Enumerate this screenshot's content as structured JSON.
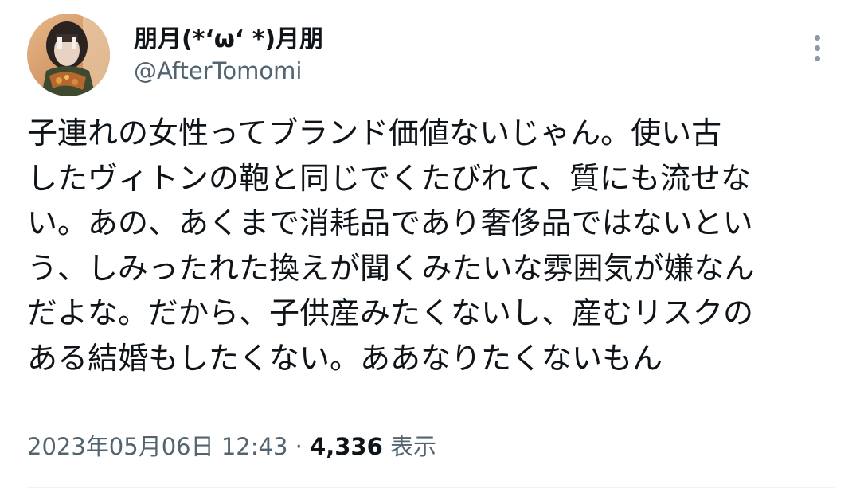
{
  "tweet": {
    "author": {
      "display_name": "朋月(*‘ω‘ *)月朋",
      "handle": "@AfterTomomi"
    },
    "text_lines": [
      "子連れの女性ってブランド価値ないじゃん。使い古",
      "したヴィトンの鞄と同じでくたびれて、質にも流せな",
      "い。あの、あくまで消耗品であり奢侈品ではないとい",
      "う、しみったれた換えが聞くみたいな雰囲気が嫌なん",
      "だよな。だから、子供産みたくないし、産むリスクの",
      "ある結婚もしたくない。ああなりたくないもん"
    ],
    "timestamp": "2023年05月06日 12:43",
    "separator": " · ",
    "views_count": "4,336",
    "views_label": " 表示",
    "more_icon": "more-vertical-icon"
  },
  "colors": {
    "text_primary": "#0f1419",
    "text_secondary": "#536471",
    "icon_gray": "#8b98a5",
    "divider": "#eff3f4"
  }
}
